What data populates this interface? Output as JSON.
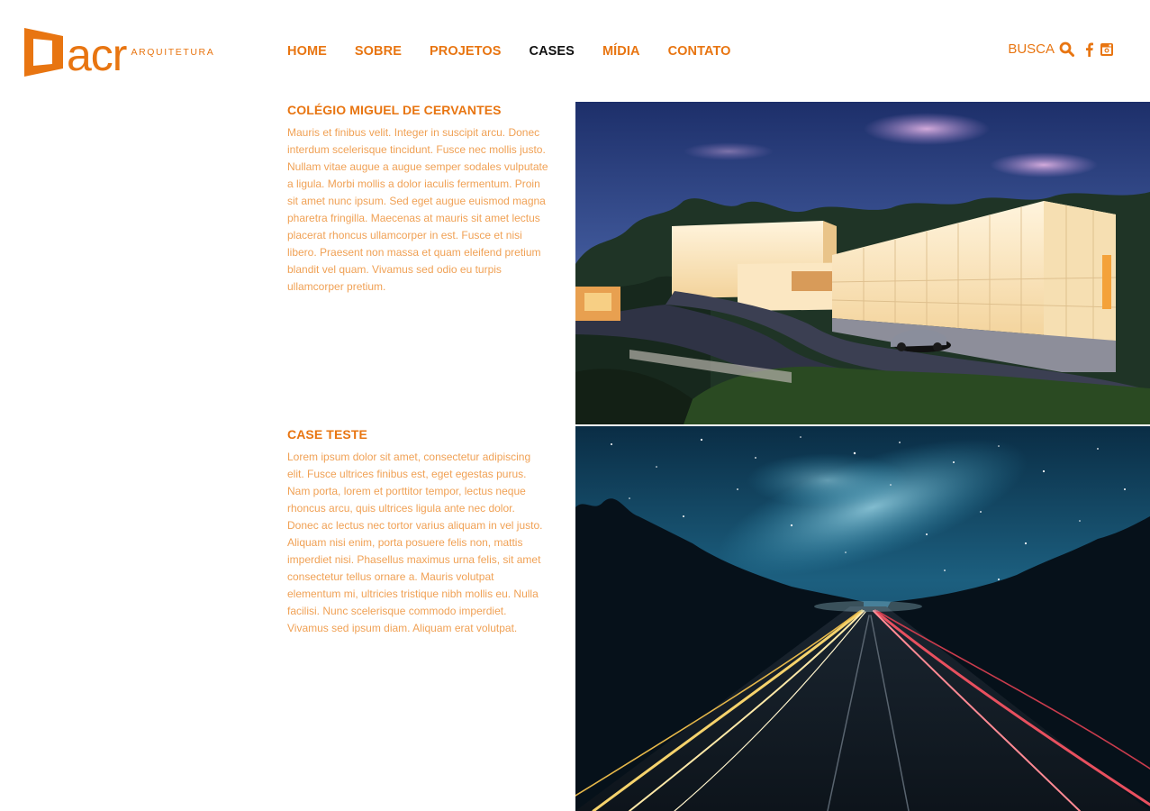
{
  "brand": {
    "name": "acr",
    "tagline": "ARQUITETURA",
    "color": "#E87511"
  },
  "nav": {
    "items": [
      {
        "label": "HOME",
        "active": false
      },
      {
        "label": "SOBRE",
        "active": false
      },
      {
        "label": "PROJETOS",
        "active": false
      },
      {
        "label": "CASES",
        "active": true
      },
      {
        "label": "MÍDIA",
        "active": false
      },
      {
        "label": "CONTATO",
        "active": false
      }
    ]
  },
  "tools": {
    "search_label": "BUSCA",
    "search_icon": "search-icon",
    "social": [
      "facebook-icon",
      "instagram-icon"
    ]
  },
  "cases": [
    {
      "title": "COLÉGIO MIGUEL DE CERVANTES",
      "body": "Mauris et finibus velit. Integer in suscipit arcu. Donec interdum scelerisque tincidunt. Fusce nec mollis justo. Nullam vitae augue a augue semper sodales vulputate a ligula. Morbi mollis a dolor iaculis fermentum. Proin sit amet nunc ipsum. Sed eget augue euismod magna pharetra fringilla. Maecenas at mauris sit amet lectus placerat rhoncus ullamcorper in est. Fusce et nisi libero. Praesent non massa et quam eleifend pretium blandit vel quam. Vivamus sed odio eu turpis ullamcorper pretium.",
      "image": "night-rendering-of-illuminated-school-building"
    },
    {
      "title": "CASE TESTE",
      "body": "Lorem ipsum dolor sit amet, consectetur adipiscing elit. Fusce ultrices finibus est, eget egestas purus. Nam porta, lorem et porttitor tempor, lectus neque rhoncus arcu, quis ultrices ligula ante nec dolor. Donec ac lectus nec tortor varius aliquam in vel justo. Aliquam nisi enim, porta posuere felis non, mattis imperdiet nisi. Phasellus maximus urna felis, sit amet consectetur tellus ornare a. Mauris volutpat elementum mi, ultricies tristique nibh mollis eu. Nulla facilisi. Nunc scelerisque commodo imperdiet. Vivamus sed ipsum diam. Aliquam erat volutpat.",
      "image": "starry-sky-over-highway-with-light-trails"
    }
  ]
}
